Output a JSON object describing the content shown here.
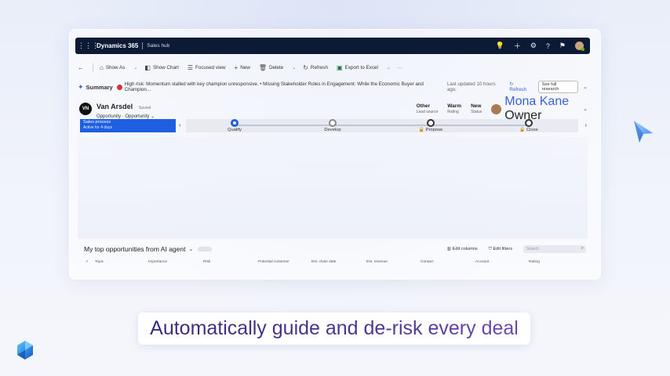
{
  "topbar": {
    "brand": "Dynamics 365",
    "hub": "Sales hub"
  },
  "commands": {
    "show_as": "Show As",
    "show_chart": "Show Chart",
    "focused_view": "Focused view",
    "new": "New",
    "delete": "Delete",
    "refresh": "Refresh",
    "export": "Export to Excel",
    "more": "···"
  },
  "summary": {
    "title": "Summary",
    "text": "High risk: Momentum stalled with key champion unresponsive. • Missing Stakeholder Roles in Engagement: While the Economic Buyer and Champion...",
    "updated": "Last updated 10 hours ago.",
    "refresh": "Refresh",
    "see_full_research": "See full research"
  },
  "record": {
    "logo_text": "VN",
    "name": "Van Arsdel",
    "saved": "Saved",
    "type": "Opportunity · Opportunity",
    "fields": [
      {
        "value": "Other",
        "label": "Lead source"
      },
      {
        "value": "Warm",
        "label": "Rating"
      },
      {
        "value": "New",
        "label": "Status"
      }
    ],
    "owner_name": "Mona Kane",
    "owner_label": "Owner"
  },
  "bpf": {
    "active_title": "Sales process",
    "active_sub": "Active for 4 days",
    "stages": [
      "Qualify",
      "Develop",
      "Propose",
      "Close"
    ]
  },
  "grid": {
    "title": "My top opportunities from AI agent",
    "edit_columns": "Edit columns",
    "edit_filters": "Edit filters",
    "search_placeholder": "Search",
    "columns": [
      "Topic",
      "Importance",
      "Risk",
      "Potential customer",
      "Est. close date",
      "Est. revenue",
      "Contact",
      "Account",
      "Rating"
    ]
  },
  "caption": "Automatically guide and de-risk every deal",
  "colors": {
    "topbar": "#0c1a36",
    "accent": "#1d5fe0",
    "risk": "#d13438",
    "caption_text": "#3b2a72"
  }
}
